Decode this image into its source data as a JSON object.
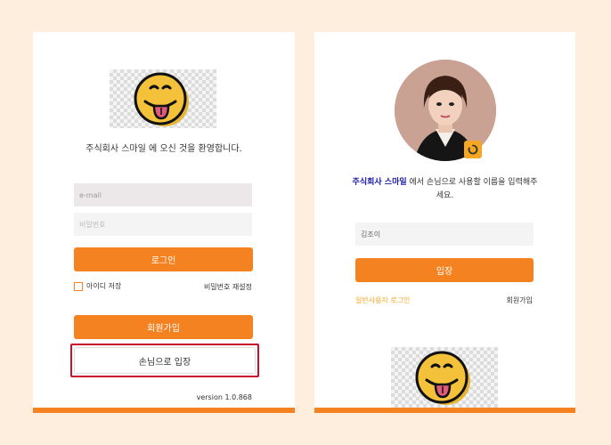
{
  "colors": {
    "accent": "#f58220",
    "background": "#fdeede",
    "highlight": "#c8102e",
    "company": "#1a1aa6",
    "link": "#f5a623"
  },
  "left": {
    "logo_icon": "smiley-tongue-icon",
    "welcome": "주식회사 스마일 에 오신 것을 환영합니다.",
    "email_placeholder": "e-mail",
    "password_placeholder": "비밀번호",
    "login_label": "로그인",
    "remember_label": "아이디 저장",
    "reset_password": "비밀번호 재설정",
    "signup_label": "회원가입",
    "guest_label": "손님으로 입장",
    "version": "version 1.0.868"
  },
  "right": {
    "avatar_icon": "user-avatar",
    "badge_icon": "loading-badge-icon",
    "company": "주식회사 스마일",
    "message": " 에서 손님으로 사용할 이름을 입력해주세요.",
    "name_value": "김조이",
    "enter_label": "입장",
    "normal_login": "일반사용자 로그인",
    "signup": "회원가입",
    "bottom_logo_icon": "smiley-tongue-icon"
  }
}
